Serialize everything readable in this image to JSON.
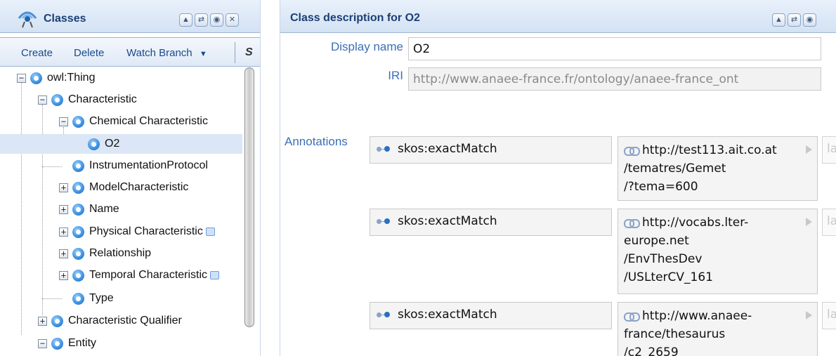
{
  "left_panel": {
    "title": "Classes",
    "header_buttons": [
      "▲",
      "⇄",
      "◉",
      "✕"
    ],
    "toolbar": {
      "create": "Create",
      "delete": "Delete",
      "watch_branch": "Watch Branch",
      "watch_caret": "▼",
      "s": "S"
    },
    "tree": [
      {
        "label": "owl:Thing",
        "expander": "−"
      },
      {
        "label": "Characteristic",
        "expander": "−"
      },
      {
        "label": "Chemical Characteristic",
        "expander": "−"
      },
      {
        "label": "O2"
      },
      {
        "label": "InstrumentationProtocol"
      },
      {
        "label": "ModelCharacteristic",
        "expander": "+"
      },
      {
        "label": "Name",
        "expander": "+"
      },
      {
        "label": "Physical Characteristic",
        "expander": "+",
        "note": "note-icon"
      },
      {
        "label": "Relationship",
        "expander": "+"
      },
      {
        "label": "Temporal Characteristic",
        "expander": "+",
        "note": "note-icon"
      },
      {
        "label": "Type"
      },
      {
        "label": "Characteristic Qualifier",
        "expander": "+"
      },
      {
        "label": "Entity",
        "expander": "−"
      }
    ],
    "selected": "O2"
  },
  "right_panel": {
    "title": "Class description for O2",
    "header_buttons": [
      "▲",
      "⇄",
      "◉"
    ],
    "display_name_label": "Display name",
    "display_name_value": "O2",
    "iri_label": "IRI",
    "iri_value": "http://www.anaee-france.fr/ontology/anaee-france_ont",
    "annotations_label": "Annotations",
    "annotations": [
      {
        "property": "skos:exactMatch",
        "value_lines": [
          "http://test113.ait.co.at",
          "/tematres/Gemet",
          "/?tema=600"
        ],
        "lang": "la"
      },
      {
        "property": "skos:exactMatch",
        "value_lines": [
          "http://vocabs.lter-",
          "europe.net",
          "/EnvThesDev",
          "/USLterCV_161"
        ],
        "lang": "la"
      },
      {
        "property": "skos:exactMatch",
        "value_lines": [
          "http://www.anaee-",
          "france/thesaurus",
          "/c2_2659"
        ],
        "lang": "la"
      }
    ]
  },
  "colors": {
    "header_title": "#1b3f73",
    "label_blue": "#3b6fb6",
    "selection": "#dbe7f6"
  }
}
